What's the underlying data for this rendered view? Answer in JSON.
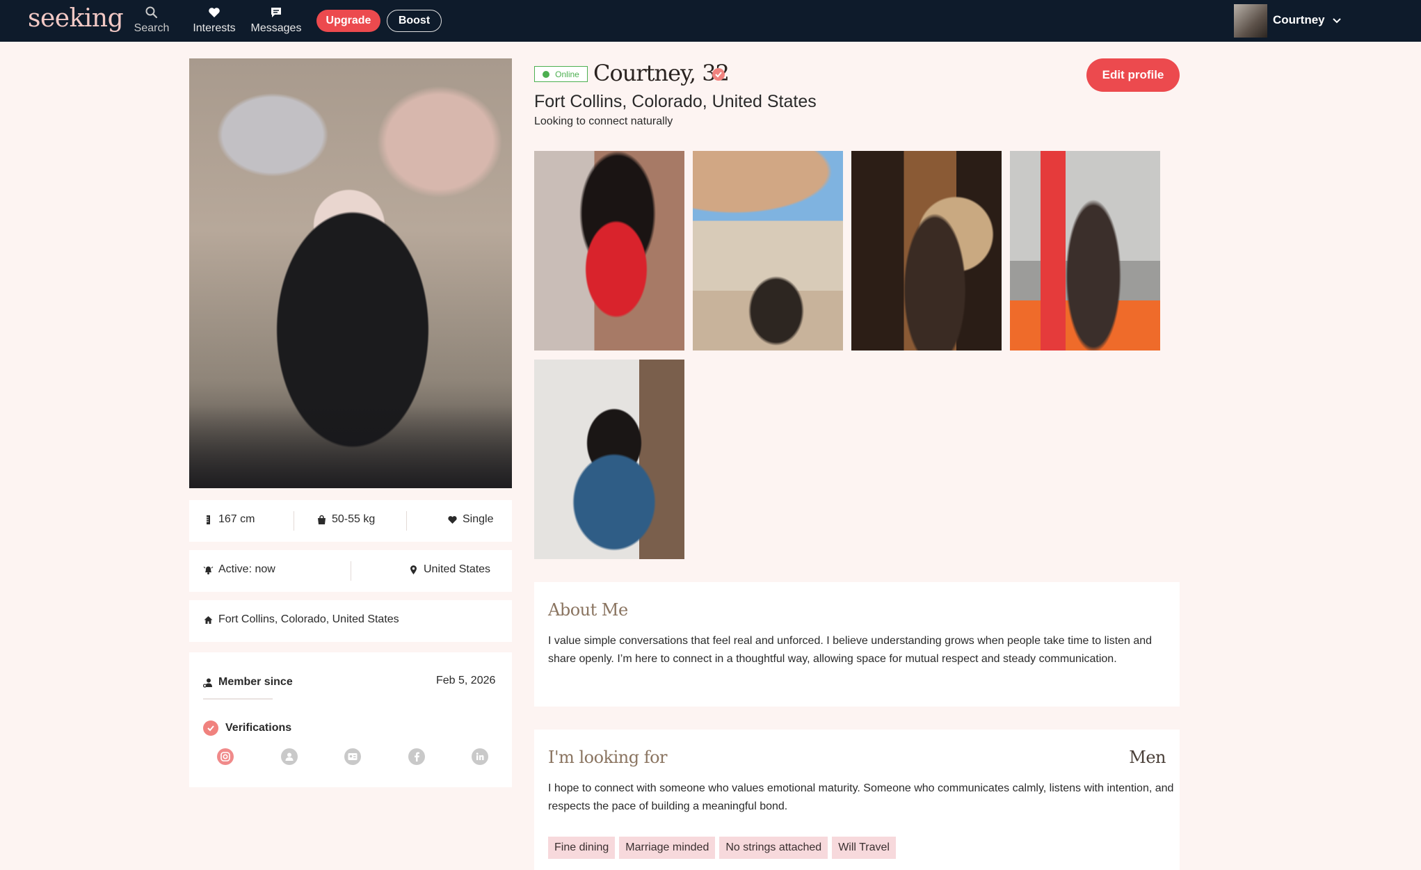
{
  "nav": {
    "logo": "seeking",
    "search_label": "Search",
    "interests_label": "Interests",
    "messages_label": "Messages",
    "upgrade_label": "Upgrade",
    "boost_label": "Boost",
    "user_name": "Courtney"
  },
  "profile": {
    "status": "Online",
    "name_age": "Courtney, 32",
    "location": "Fort Collins, Colorado, United States",
    "tagline": "Looking to connect naturally",
    "edit_label": "Edit profile"
  },
  "stats": {
    "height": "167 cm",
    "weight": "50-55 kg",
    "relationship": "Single",
    "active": "Active: now",
    "country": "United States",
    "hometown": "Fort Collins, Colorado, United States"
  },
  "membership": {
    "member_since_label": "Member since",
    "member_since_value": "Feb 5, 2026",
    "verifications_label": "Verifications",
    "verification_icons": [
      "instagram-icon",
      "profile-icon",
      "id-icon",
      "facebook-icon",
      "linkedin-icon"
    ]
  },
  "about": {
    "title": "About Me",
    "text": "I value simple conversations that feel real and unforced. I believe understanding grows when people take time to listen and share openly. I’m here to connect in a thoughtful way, allowing space for mutual respect and steady communication."
  },
  "looking_for": {
    "title": "I'm looking for",
    "value": "Men",
    "text": "I hope to connect with someone who values emotional maturity. Someone who communicates calmly, listens with intention, and respects the pace of building a meaningful bond.",
    "tags": [
      "Fine dining",
      "Marriage minded",
      "No strings attached",
      "Will Travel"
    ]
  },
  "colors": {
    "nav_bg": "#0e1b2b",
    "accent": "#ec4a4e",
    "page_bg": "#fdf4f2",
    "tag_bg": "#f7d9dc",
    "online": "#4caf50"
  }
}
